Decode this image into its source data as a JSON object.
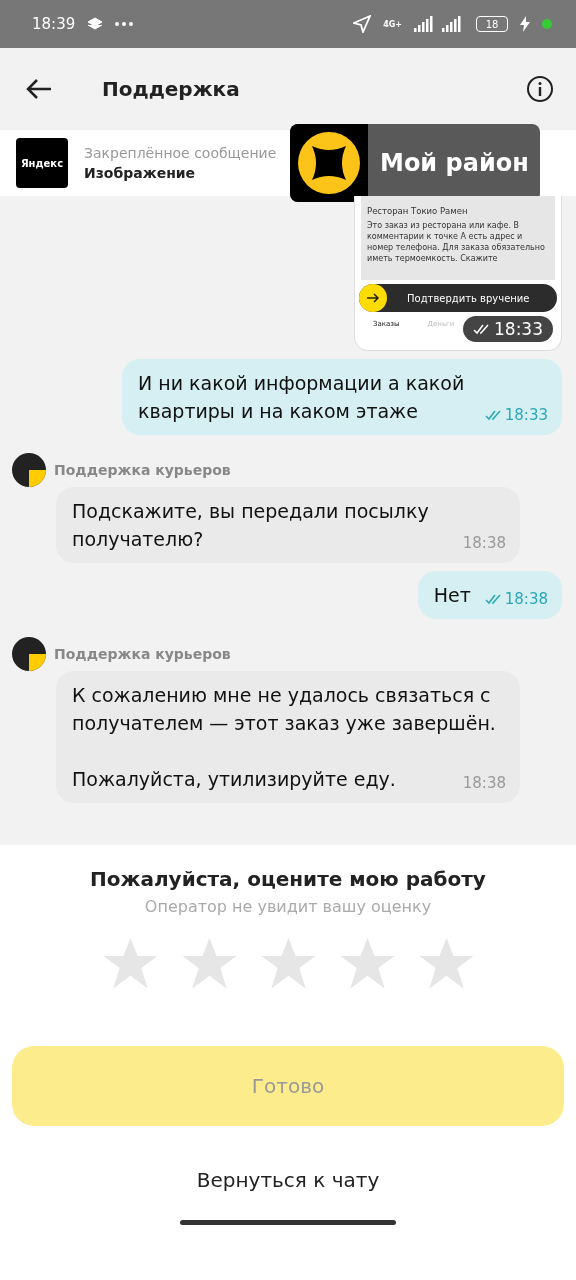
{
  "status_bar": {
    "time": "18:39",
    "network": "4G+",
    "battery": "18"
  },
  "header": {
    "title": "Поддержка"
  },
  "pinned": {
    "logo": "Яндекс",
    "label": "Закреплённое сообщение",
    "text": "Изображение"
  },
  "overlay_badge": {
    "title": "Мой район"
  },
  "messages": [
    {
      "kind": "image",
      "image": {
        "list_item": "Ресторан Токио Рамен",
        "paragraph": "Это заказ из ресторана или кафе. В комментарии к точке А есть адрес и номер телефона. Для заказа обязательно иметь термоемкость. Скажите",
        "action": "Подтвердить вручение",
        "tabs": [
          "Заказы",
          "Деньги"
        ]
      },
      "time": "18:33",
      "read": true
    },
    {
      "kind": "outgoing",
      "text": "И ни какой информации а какой квартиры и на каком этаже",
      "time": "18:33",
      "read": true
    },
    {
      "kind": "incoming",
      "sender": "Поддержка курьеров",
      "text": "Подскажите, вы передали посылку получателю?",
      "time": "18:38"
    },
    {
      "kind": "outgoing",
      "text": "Нет",
      "time": "18:38",
      "read": true
    },
    {
      "kind": "incoming",
      "sender": "Поддержка курьеров",
      "text": "К сожалению мне не удалось связаться с получателем — этот заказ уже завершён.\n\nПожалуйста, утилизируйте еду.",
      "time": "18:38"
    }
  ],
  "rating": {
    "title": "Пожалуйста, оцените мою работу",
    "subtitle": "Оператор не увидит вашу оценку",
    "stars": 0
  },
  "done_button": {
    "label": "Готово",
    "disabled": true
  },
  "back_link": {
    "label": "Вернуться к чату"
  }
}
